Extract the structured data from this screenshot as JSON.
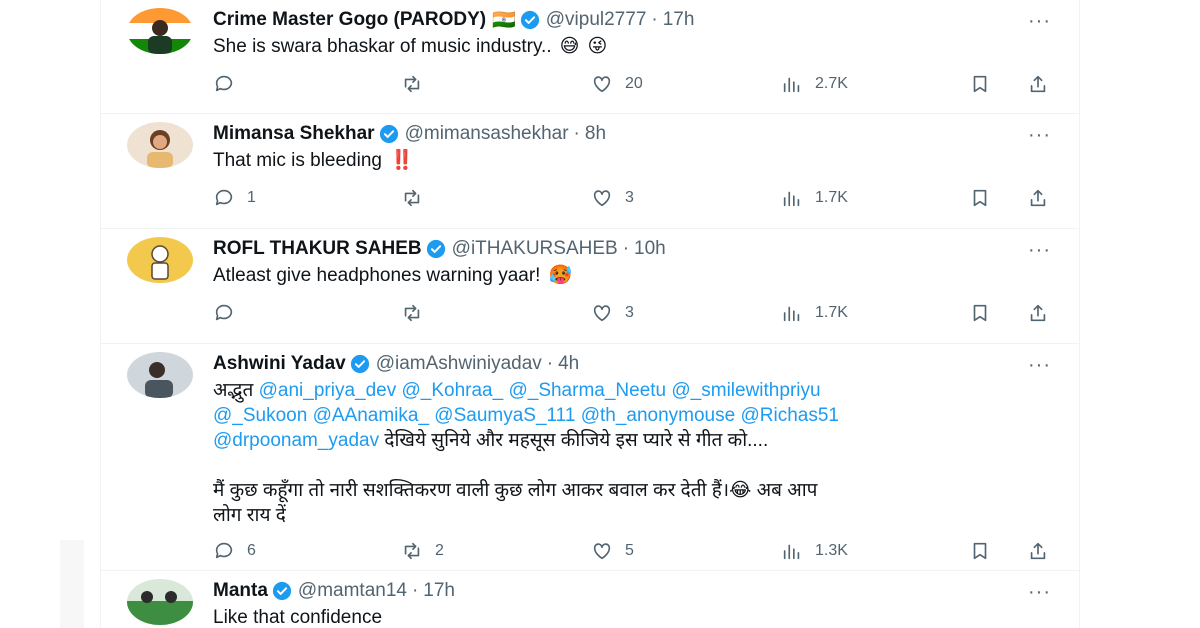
{
  "tweets": [
    {
      "name": "Crime Master Gogo (PARODY)",
      "flag": "🇮🇳",
      "handle": "@vipul2777",
      "time": "17h",
      "text": "She is swara bhaskar of music industry..",
      "emojis": [
        "😅",
        "😜"
      ],
      "counts": {
        "replies": "",
        "retweets": "",
        "likes": "20",
        "views": "2.7K"
      },
      "avatar_color": "#2e7d32"
    },
    {
      "name": "Mimansa Shekhar",
      "handle": "@mimansashekhar",
      "time": "8h",
      "text": "That mic is bleeding",
      "emojis": [
        "‼️"
      ],
      "counts": {
        "replies": "1",
        "retweets": "",
        "likes": "3",
        "views": "1.7K"
      },
      "avatar_color": "#d7b49e"
    },
    {
      "name": "ROFL THAKUR SAHEB",
      "handle": "@iTHAKURSAHEB",
      "time": "10h",
      "text": "Atleast give headphones warning yaar!",
      "emojis": [
        "🥵"
      ],
      "counts": {
        "replies": "",
        "retweets": "",
        "likes": "3",
        "views": "1.7K"
      },
      "avatar_color": "#f2c94c"
    },
    {
      "name": "Ashwini Yadav",
      "handle": "@iamAshwiniyadav",
      "time": "4h",
      "text_parts": {
        "lead": "अद्भुत",
        "mentions_line1": "@ani_priya_dev @_Kohraa_ @_Sharma_Neetu @_smilewithpriyu",
        "mentions_line2": "@_Sukoon @AAnamika_ @SaumyaS_111 @th_anonymouse @Richas51",
        "mention_line3": "@drpoonam_yadav",
        "line3_rest": "देखिये सुनिये और महसूस कीजिये इस प्यारे से गीत को....",
        "para2_a": "मैं कुछ कहूँगा तो नारी सशक्तिकरण वाली कुछ लोग आकर बवाल कर देती हैं।",
        "para2_emoji": "😂",
        "para2_b": "अब आप",
        "para2_c": "लोग राय दें"
      },
      "counts": {
        "replies": "6",
        "retweets": "2",
        "likes": "5",
        "views": "1.3K"
      },
      "avatar_color": "#5b6670"
    },
    {
      "name": "Manta",
      "handle": "@mamtan14",
      "time": "17h",
      "text": "Like that confidence",
      "avatar_color": "#3e8e41"
    }
  ],
  "separator": "·",
  "more_label": "···",
  "colors": {
    "accent": "#1d9bf0",
    "muted": "#536471",
    "text": "#0f1419"
  },
  "icons": [
    "reply-icon",
    "retweet-icon",
    "like-icon",
    "views-icon",
    "bookmark-icon",
    "share-icon",
    "verified-badge-icon",
    "more-icon"
  ]
}
